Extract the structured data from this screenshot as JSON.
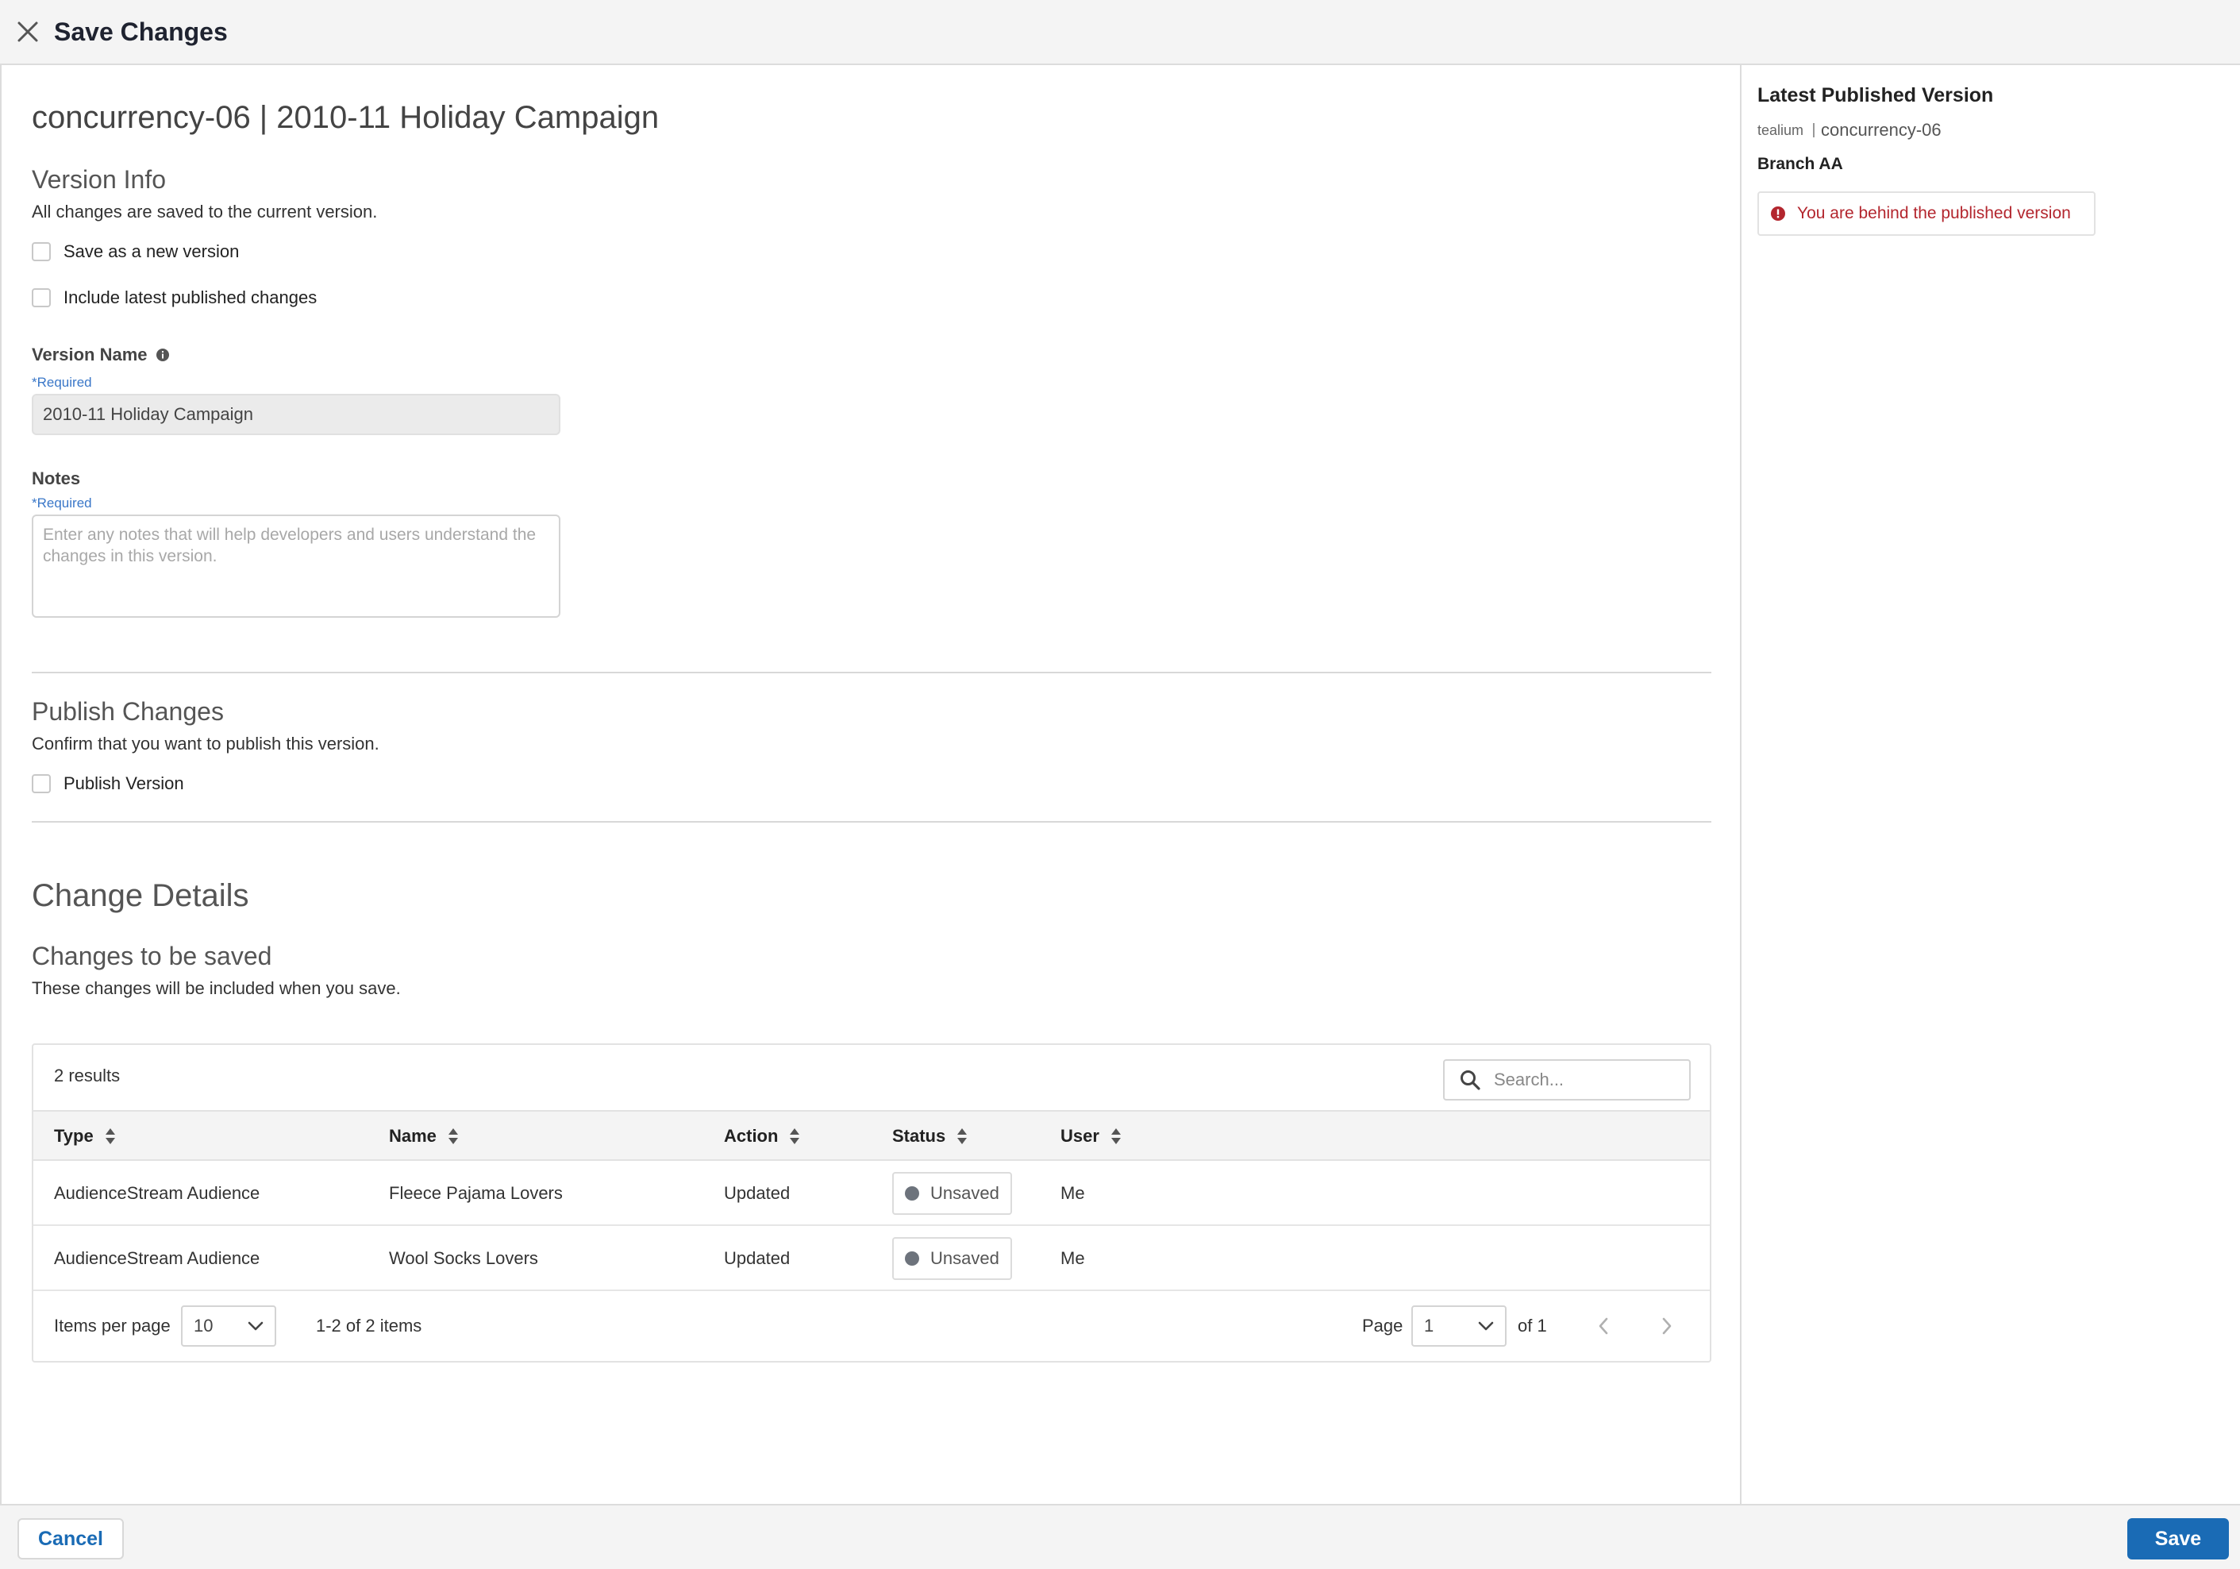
{
  "header": {
    "title": "Save Changes",
    "close_icon": "close-icon"
  },
  "main": {
    "heading": "concurrency-06 | 2010-11 Holiday Campaign",
    "version_info": {
      "title": "Version Info",
      "description": "All changes are saved to the current version.",
      "save_new_label": "Save as a new version",
      "include_latest_label": "Include latest published changes"
    },
    "version_name": {
      "label": "Version Name",
      "required": "*Required",
      "value": "2010-11 Holiday Campaign"
    },
    "notes": {
      "label": "Notes",
      "required": "*Required",
      "placeholder": "Enter any notes that will help developers and users understand the changes in this version."
    },
    "publish": {
      "title": "Publish Changes",
      "description": "Confirm that you want to publish this version.",
      "checkbox_label": "Publish Version"
    },
    "change_details": {
      "title": "Change Details",
      "subtitle": "Changes to be saved",
      "description": "These changes will be included when you save."
    }
  },
  "table": {
    "results": "2 results",
    "search_placeholder": "Search...",
    "columns": [
      "Type",
      "Name",
      "Action",
      "Status",
      "User"
    ],
    "rows": [
      {
        "type": "AudienceStream Audience",
        "name": "Fleece Pajama Lovers",
        "action": "Updated",
        "status": "Unsaved",
        "user": "Me"
      },
      {
        "type": "AudienceStream Audience",
        "name": "Wool Socks Lovers",
        "action": "Updated",
        "status": "Unsaved",
        "user": "Me"
      }
    ],
    "pagination": {
      "items_per_page_label": "Items per page",
      "items_per_page": "10",
      "range": "1-2 of 2 items",
      "page_label": "Page",
      "page": "1",
      "of_label": "of 1"
    }
  },
  "side_panel": {
    "title": "Latest Published Version",
    "account": "tealium",
    "profile": "concurrency-06",
    "branch": "Branch AA",
    "warning": "You are behind the published version"
  },
  "footer": {
    "cancel_label": "Cancel",
    "save_label": "Save"
  },
  "colors": {
    "primary": "#1a6bb5",
    "warning": "#b3262e",
    "status_unsaved": "#6d737c",
    "required": "#3a77c8"
  }
}
